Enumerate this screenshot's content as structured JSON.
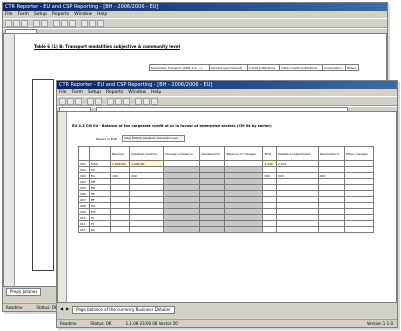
{
  "back_window": {
    "title": "CTR Reporter - EU and CSP Reporting - [BH - 2006/2006 - EU]",
    "menu": [
      "File",
      "Form",
      "Setup",
      "Reports",
      "Window",
      "Help"
    ],
    "sheet_title": "Table 6 (1) B: Transport modalities subjective & community level",
    "columns": [
      "Secondary transport (CMS 1.4, ...)",
      "Carriers (permanent)",
      "Credit institutions",
      "Other credit institutions",
      "Corporation",
      "Mixed"
    ],
    "tab_label": "Prepo Jutanes",
    "status_left": "Readme",
    "status_right": "Status: Ok"
  },
  "front_window": {
    "title": "CTR Reporter - EU and CSP Reporting - [BH - 2006/2006 - EU]",
    "menu": [
      "File",
      "Form",
      "Setup",
      "Reports",
      "Window",
      "Help"
    ],
    "sheet_title": "EU 4.3 CM 04 - Balance of the corporate credit at or in favour of enterprise sectors (CM 04 by sector)",
    "label_field": "Report in EUR",
    "dropdown_value": "Total EUR(S) bilateral domestic loan",
    "column_headers": [
      "Balance",
      "Adjusted balance",
      "Change in balance",
      "Adjustments",
      "Balance of changes",
      "Total",
      "Statistical adjustment",
      "Revaluations",
      "Other changes"
    ],
    "row_labels": [
      "Total",
      "EU",
      "EA",
      "EB",
      "ED",
      "EE",
      "EF",
      "EG",
      "EH",
      "EI",
      "EJ",
      "EK"
    ],
    "row_codes": [
      "001",
      "002",
      "003",
      "004",
      "005",
      "006",
      "007",
      "008",
      "009",
      "010",
      "011",
      "012"
    ],
    "sample_values": [
      "1 000,00",
      "1 000,00",
      "100",
      "200",
      "300",
      "1 120",
      "2 100",
      "300",
      "400"
    ],
    "tab_label": "Page balance of the currency Business Detailer",
    "status_left": "Readme",
    "status_mid": "Status: OK",
    "status_date": "1.1.08 23:00 08 Vector 20",
    "status_right": "Version 1.1.0"
  }
}
